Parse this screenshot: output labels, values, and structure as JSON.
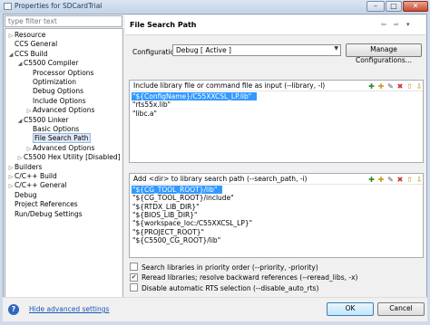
{
  "window": {
    "title": "Properties for SDCardTrial",
    "minimize": "–",
    "maximize": "□",
    "close": "✕"
  },
  "filter": {
    "placeholder": "type filter text"
  },
  "tree": [
    {
      "label": "Resource",
      "arrow": "▷",
      "indent": 0
    },
    {
      "label": "CCS General",
      "arrow": "",
      "indent": 0
    },
    {
      "label": "CCS Build",
      "arrow": "◢",
      "indent": 0
    },
    {
      "label": "C5500 Compiler",
      "arrow": "◢",
      "indent": 1
    },
    {
      "label": "Processor Options",
      "arrow": "",
      "indent": 2
    },
    {
      "label": "Optimization",
      "arrow": "",
      "indent": 2
    },
    {
      "label": "Debug Options",
      "arrow": "",
      "indent": 2
    },
    {
      "label": "Include Options",
      "arrow": "",
      "indent": 2
    },
    {
      "label": "Advanced Options",
      "arrow": "▷",
      "indent": 2
    },
    {
      "label": "C5500 Linker",
      "arrow": "◢",
      "indent": 1
    },
    {
      "label": "Basic Options",
      "arrow": "",
      "indent": 2
    },
    {
      "label": "File Search Path",
      "arrow": "",
      "indent": 2,
      "selected": true
    },
    {
      "label": "Advanced Options",
      "arrow": "▷",
      "indent": 2
    },
    {
      "label": "C5500 Hex Utility  [Disabled]",
      "arrow": "▷",
      "indent": 1
    },
    {
      "label": "Builders",
      "arrow": "▷",
      "indent": 0
    },
    {
      "label": "C/C++ Build",
      "arrow": "▷",
      "indent": 0
    },
    {
      "label": "C/C++ General",
      "arrow": "▷",
      "indent": 0
    },
    {
      "label": "Debug",
      "arrow": "",
      "indent": 0
    },
    {
      "label": "Project References",
      "arrow": "",
      "indent": 0
    },
    {
      "label": "Run/Debug Settings",
      "arrow": "",
      "indent": 0
    }
  ],
  "page": {
    "title": "File Search Path",
    "back": "⇦",
    "fwd": "⇨",
    "menu": "▾"
  },
  "configuration": {
    "label": "Configuration:",
    "value": "Debug  [ Active ]",
    "manage_button": "Manage Configurations..."
  },
  "library_group": {
    "heading": "Include library file or command file as input (--library, -l)",
    "items": [
      "\"${ConfigName}/C55XXCSL_LP.lib\"",
      "\"rts55x.lib\"",
      "\"libc.a\""
    ],
    "tools": [
      "add-icon",
      "add-workspace-icon",
      "edit-icon",
      "delete-icon",
      "move-up-icon",
      "move-down-icon"
    ]
  },
  "search_group": {
    "heading": "Add <dir> to library search path (--search_path, -i)",
    "items": [
      "\"${CG_TOOL_ROOT}/lib\"",
      "\"${CG_TOOL_ROOT}/include\"",
      "\"${RTDX_LIB_DIR}\"",
      "\"${BIOS_LIB_DIR}\"",
      "\"${workspace_loc:/C55XXCSL_LP}\"",
      "\"${PROJECT_ROOT}\"",
      "\"${C5500_CG_ROOT}/lib\""
    ],
    "tools": [
      "add-icon",
      "add-workspace-icon",
      "edit-icon",
      "delete-icon",
      "move-up-icon",
      "move-down-icon"
    ]
  },
  "options": [
    {
      "label": "Search libraries in priority order (--priority, -priority)",
      "checked": false
    },
    {
      "label": "Reread libraries; resolve backward references (--reread_libs, -x)",
      "checked": true
    },
    {
      "label": "Disable automatic RTS selection (--disable_auto_rts)",
      "checked": false
    }
  ],
  "footer": {
    "help_icon": "?",
    "link": "Hide advanced settings",
    "ok": "OK",
    "cancel": "Cancel"
  }
}
